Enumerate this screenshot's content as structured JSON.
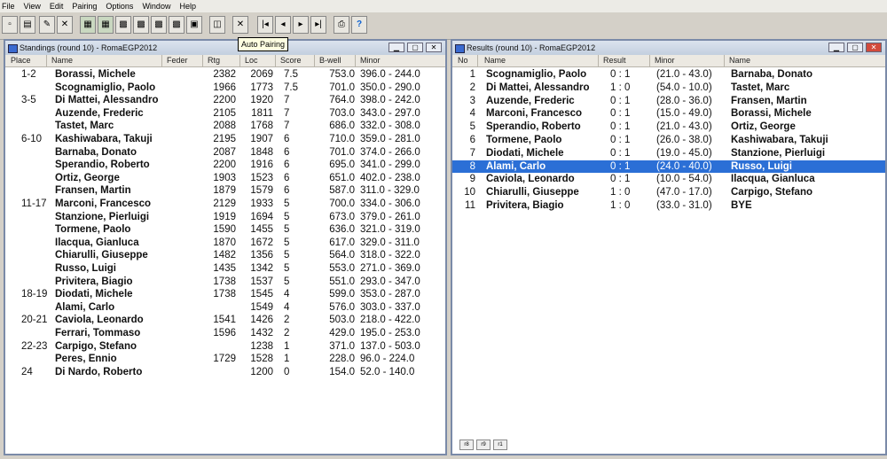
{
  "menu": [
    "File",
    "View",
    "Edit",
    "Pairing",
    "Options",
    "Window",
    "Help"
  ],
  "toolbar": {
    "tooltip": "Auto Pairing",
    "help_glyph": "?"
  },
  "standings": {
    "title": "Standings  (round 10) - RomaEGP2012",
    "headers": {
      "place": "Place",
      "name": "Name",
      "feder": "Feder",
      "rtg": "Rtg",
      "loc": "Loc",
      "score": "Score",
      "bwell": "B-well",
      "minor": "Minor"
    },
    "rows": [
      {
        "place": "1-2",
        "name": "Borassi, Michele",
        "rtg": "2382",
        "loc": "2069",
        "score": "7.5",
        "bwell": "753.0",
        "minor": "396.0  -  244.0"
      },
      {
        "place": "",
        "name": "Scognamiglio, Paolo",
        "rtg": "1966",
        "loc": "1773",
        "score": "7.5",
        "bwell": "701.0",
        "minor": "350.0  -  290.0"
      },
      {
        "place": "3-5",
        "name": "Di Mattei, Alessandro",
        "rtg": "2200",
        "loc": "1920",
        "score": "7",
        "bwell": "764.0",
        "minor": "398.0  -  242.0"
      },
      {
        "place": "",
        "name": "Auzende, Frederic",
        "rtg": "2105",
        "loc": "1811",
        "score": "7",
        "bwell": "703.0",
        "minor": "343.0  -  297.0"
      },
      {
        "place": "",
        "name": "Tastet, Marc",
        "rtg": "2088",
        "loc": "1768",
        "score": "7",
        "bwell": "686.0",
        "minor": "332.0  -  308.0"
      },
      {
        "place": "6-10",
        "name": "Kashiwabara, Takuji",
        "rtg": "2195",
        "loc": "1907",
        "score": "6",
        "bwell": "710.0",
        "minor": "359.0  -  281.0"
      },
      {
        "place": "",
        "name": "Barnaba, Donato",
        "rtg": "2087",
        "loc": "1848",
        "score": "6",
        "bwell": "701.0",
        "minor": "374.0  -  266.0"
      },
      {
        "place": "",
        "name": "Sperandio, Roberto",
        "rtg": "2200",
        "loc": "1916",
        "score": "6",
        "bwell": "695.0",
        "minor": "341.0  -  299.0"
      },
      {
        "place": "",
        "name": "Ortiz, George",
        "rtg": "1903",
        "loc": "1523",
        "score": "6",
        "bwell": "651.0",
        "minor": "402.0  -  238.0"
      },
      {
        "place": "",
        "name": "Fransen, Martin",
        "rtg": "1879",
        "loc": "1579",
        "score": "6",
        "bwell": "587.0",
        "minor": "311.0  -  329.0"
      },
      {
        "place": "11-17",
        "name": "Marconi, Francesco",
        "rtg": "2129",
        "loc": "1933",
        "score": "5",
        "bwell": "700.0",
        "minor": "334.0  -  306.0"
      },
      {
        "place": "",
        "name": "Stanzione, Pierluigi",
        "rtg": "1919",
        "loc": "1694",
        "score": "5",
        "bwell": "673.0",
        "minor": "379.0  -  261.0"
      },
      {
        "place": "",
        "name": "Tormene, Paolo",
        "rtg": "1590",
        "loc": "1455",
        "score": "5",
        "bwell": "636.0",
        "minor": "321.0  -  319.0"
      },
      {
        "place": "",
        "name": "Ilacqua, Gianluca",
        "rtg": "1870",
        "loc": "1672",
        "score": "5",
        "bwell": "617.0",
        "minor": "329.0  -  311.0"
      },
      {
        "place": "",
        "name": "Chiarulli, Giuseppe",
        "rtg": "1482",
        "loc": "1356",
        "score": "5",
        "bwell": "564.0",
        "minor": "318.0  -  322.0"
      },
      {
        "place": "",
        "name": "Russo, Luigi",
        "rtg": "1435",
        "loc": "1342",
        "score": "5",
        "bwell": "553.0",
        "minor": "271.0  -  369.0"
      },
      {
        "place": "",
        "name": "Privitera, Biagio",
        "rtg": "1738",
        "loc": "1537",
        "score": "5",
        "bwell": "551.0",
        "minor": "293.0  -  347.0"
      },
      {
        "place": "18-19",
        "name": "Diodati, Michele",
        "rtg": "1738",
        "loc": "1545",
        "score": "4",
        "bwell": "599.0",
        "minor": "353.0  -  287.0"
      },
      {
        "place": "",
        "name": "Alami, Carlo",
        "rtg": "",
        "loc": "1549",
        "score": "4",
        "bwell": "576.0",
        "minor": "303.0  -  337.0"
      },
      {
        "place": "20-21",
        "name": "Caviola, Leonardo",
        "rtg": "1541",
        "loc": "1426",
        "score": "2",
        "bwell": "503.0",
        "minor": "218.0  -  422.0"
      },
      {
        "place": "",
        "name": "Ferrari, Tommaso",
        "rtg": "1596",
        "loc": "1432",
        "score": "2",
        "bwell": "429.0",
        "minor": "195.0  -  253.0"
      },
      {
        "place": "22-23",
        "name": "Carpigo, Stefano",
        "rtg": "",
        "loc": "1238",
        "score": "1",
        "bwell": "371.0",
        "minor": "137.0  -  503.0"
      },
      {
        "place": "",
        "name": "Peres, Ennio",
        "rtg": "1729",
        "loc": "1528",
        "score": "1",
        "bwell": "228.0",
        "minor": "96.0  -  224.0"
      },
      {
        "place": "24",
        "name": "Di Nardo, Roberto",
        "rtg": "",
        "loc": "1200",
        "score": "0",
        "bwell": "154.0",
        "minor": "52.0  -  140.0"
      }
    ]
  },
  "results": {
    "title": "Results  (round 10) - RomaEGP2012",
    "headers": {
      "no": "No",
      "name": "Name",
      "result": "Result",
      "minor": "Minor",
      "name2": "Name"
    },
    "selected_index": 7,
    "rows": [
      {
        "no": "1",
        "name": "Scognamiglio, Paolo",
        "result": "0  :  1",
        "minor": "(21.0  -  43.0)",
        "name2": "Barnaba, Donato"
      },
      {
        "no": "2",
        "name": "Di Mattei, Alessandro",
        "result": "1  :  0",
        "minor": "(54.0  -  10.0)",
        "name2": "Tastet, Marc"
      },
      {
        "no": "3",
        "name": "Auzende, Frederic",
        "result": "0  :  1",
        "minor": "(28.0  -  36.0)",
        "name2": "Fransen, Martin"
      },
      {
        "no": "4",
        "name": "Marconi, Francesco",
        "result": "0  :  1",
        "minor": "(15.0  -  49.0)",
        "name2": "Borassi, Michele"
      },
      {
        "no": "5",
        "name": "Sperandio, Roberto",
        "result": "0  :  1",
        "minor": "(21.0  -  43.0)",
        "name2": "Ortiz, George"
      },
      {
        "no": "6",
        "name": "Tormene, Paolo",
        "result": "0  :  1",
        "minor": "(26.0  -  38.0)",
        "name2": "Kashiwabara, Takuji"
      },
      {
        "no": "7",
        "name": "Diodati, Michele",
        "result": "0  :  1",
        "minor": "(19.0  -  45.0)",
        "name2": "Stanzione, Pierluigi"
      },
      {
        "no": "8",
        "name": "Alami, Carlo",
        "result": "0  :  1",
        "minor": "(24.0  -  40.0)",
        "name2": "Russo, Luigi"
      },
      {
        "no": "9",
        "name": "Caviola, Leonardo",
        "result": "0  :  1",
        "minor": "(10.0  -  54.0)",
        "name2": "Ilacqua, Gianluca"
      },
      {
        "no": "10",
        "name": "Chiarulli, Giuseppe",
        "result": "1  :  0",
        "minor": "(47.0  -  17.0)",
        "name2": "Carpigo, Stefano"
      },
      {
        "no": "11",
        "name": "Privitera, Biagio",
        "result": "1  :  0",
        "minor": "(33.0  -  31.0)",
        "name2": "BYE"
      }
    ],
    "page_buttons": [
      "r8",
      "r9",
      "r1"
    ]
  },
  "colors": {
    "selection": "#2b6fd6",
    "window_border": "#7a8aa8",
    "tooltip_bg": "#ffffe1"
  }
}
